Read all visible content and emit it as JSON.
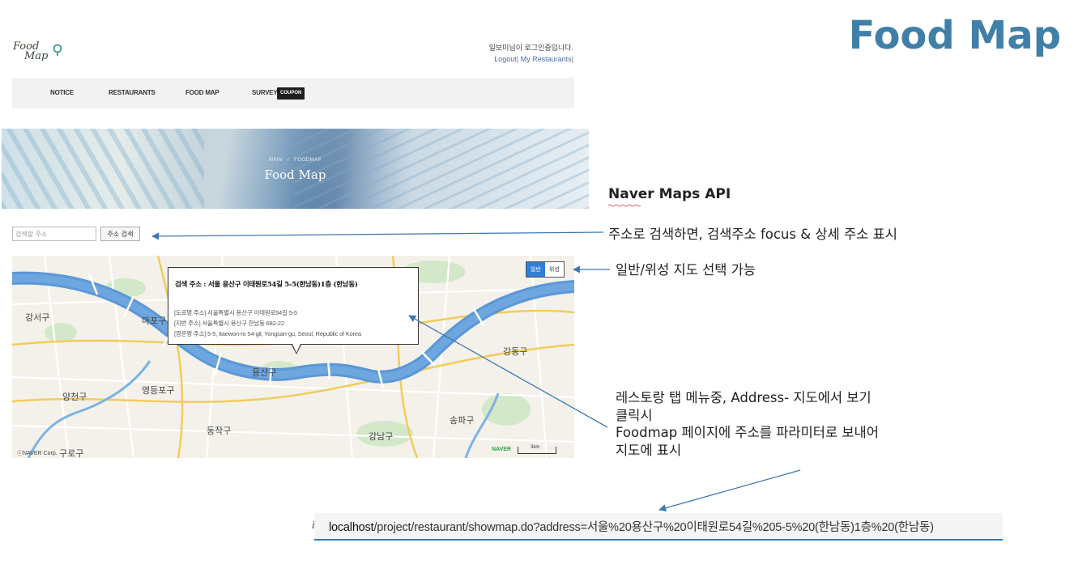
{
  "slide": {
    "title": "Food Map"
  },
  "header": {
    "logo_text_line1": "Food",
    "logo_text_line2": "Map",
    "login_message": "일보미님이 로그인중입니다.",
    "logout_label": "Logout",
    "my_restaurants_label": "My Restaurants",
    "separator": "|"
  },
  "nav": {
    "items": [
      {
        "label": "NOTICE"
      },
      {
        "label": "RESTAURANTS"
      },
      {
        "label": "FOOD MAP"
      },
      {
        "label": "SURVEY"
      }
    ],
    "coupon_badge": "COUPON"
  },
  "banner": {
    "crumb_main": "MAIN",
    "crumb_sep": "/",
    "crumb_current": "FOODMAP",
    "title": "Food Map"
  },
  "search": {
    "placeholder": "검색할 주소",
    "button_label": "주소 검색"
  },
  "map": {
    "type_normal": "일반",
    "type_satellite": "위성",
    "labels": {
      "gangseo": "강서구",
      "mapo": "마포구",
      "yangcheon": "양천구",
      "yeongdeungpo": "영등포구",
      "yongsan": "용산구",
      "dongjak": "동작구",
      "gangnam": "강남구",
      "songpa": "송파구",
      "gangdong": "강동구",
      "guro": "구로구"
    },
    "copyright": "ⓒNAVER Corp.",
    "naver_logo": "NAVER",
    "scale": "3km",
    "infowindow": {
      "title": "검색 주소 : 서울 용산구 이태원로54길 5-5(한남동)1층 (한남동)",
      "road": "[도로명 주소] 서울특별시 용산구 이태원로54길 5-5",
      "jibun": "[지번 주소] 서울특별시 용산구 한남동 682-22",
      "english": "[영문명 주소] 5-5, Itaewon-ro 54-gil, Yongsan-gu, Seoul, Republic of Korea"
    }
  },
  "annotations": {
    "api": "Naver Maps API",
    "search_desc": "주소로 검색하면, 검색주소 focus & 상세 주소 표시",
    "maptype_desc": "일반/위성 지도 선택 가능",
    "tab_line1": "레스토랑 탭 메뉴중, Address- 지도에서 보기",
    "tab_line2": "클릭시",
    "tab_line3": "Foodmap 페이지에 주소를 파라미터로 보내어",
    "tab_line4": "지도에 표시"
  },
  "urlbar": {
    "icon": "i",
    "host": "localhost",
    "path": "/project/restaurant/showmap.do?address=서울%20용산구%20이태원로54길%205-5%20(한남동)1층%20(한남동)"
  },
  "colors": {
    "title_blue": "#3f7fa8",
    "river": "#5b97d6",
    "accent_blue": "#2f7fd6",
    "url_underline": "#2e7cb8"
  }
}
